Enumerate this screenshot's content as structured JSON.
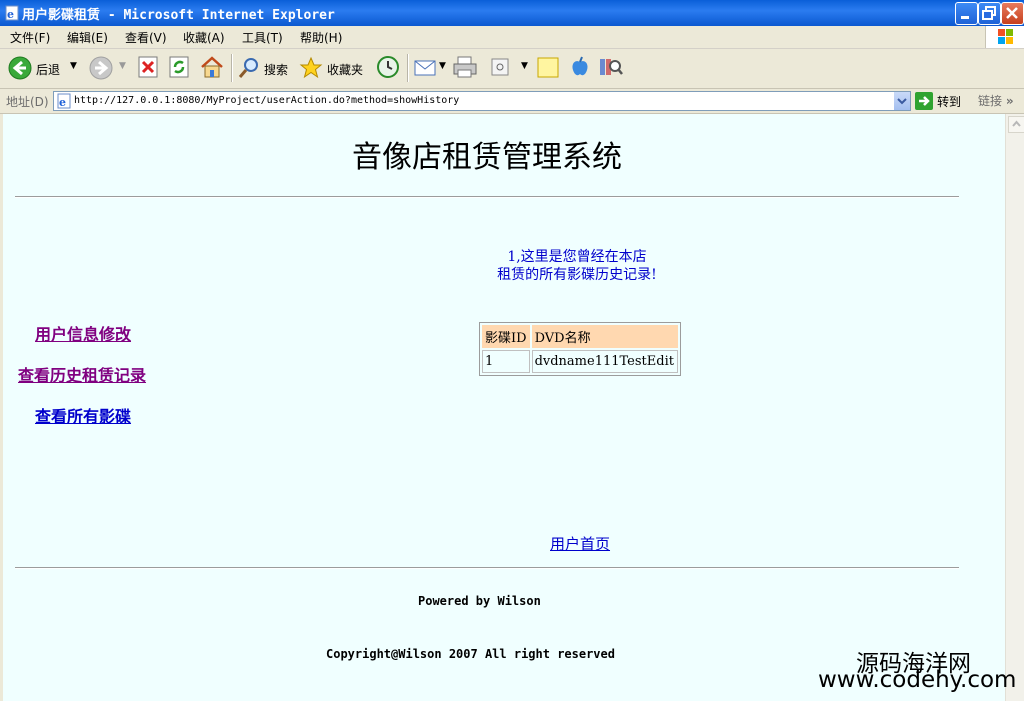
{
  "window": {
    "title": "用户影碟租赁 - Microsoft Internet Explorer"
  },
  "menu": {
    "items": [
      "文件(F)",
      "编辑(E)",
      "查看(V)",
      "收藏(A)",
      "工具(T)",
      "帮助(H)"
    ]
  },
  "toolbar": {
    "back_label": "后退",
    "search_label": "搜索",
    "favorites_label": "收藏夹"
  },
  "address": {
    "label": "地址(D)",
    "url": "http://127.0.0.1:8080/MyProject/userAction.do?method=showHistory",
    "go_label": "转到",
    "links_label": "链接"
  },
  "page": {
    "title": "音像店租赁管理系统",
    "info_line1": "1,这里是您曾经在本店",
    "info_line2": "租赁的所有影碟历史记录!",
    "nav": {
      "edit_user": "用户信息修改",
      "history": "查看历史租赁记录",
      "all_discs": "查看所有影碟"
    },
    "table": {
      "headers": [
        "影碟ID",
        "DVD名称"
      ],
      "rows": [
        [
          "1",
          "dvdname111TestEdit"
        ]
      ]
    },
    "home_link": "用户首页",
    "powered": "Powered by Wilson",
    "copyright": "Copyright@Wilson 2007 All right reserved"
  },
  "watermark": {
    "line1": "源码海洋网",
    "line2": "www.codehy.com"
  },
  "colors": {
    "page_bg": "#f0ffff",
    "link_visited": "#800080",
    "link": "#0000cc",
    "table_header_bg": "#ffd8b0"
  }
}
